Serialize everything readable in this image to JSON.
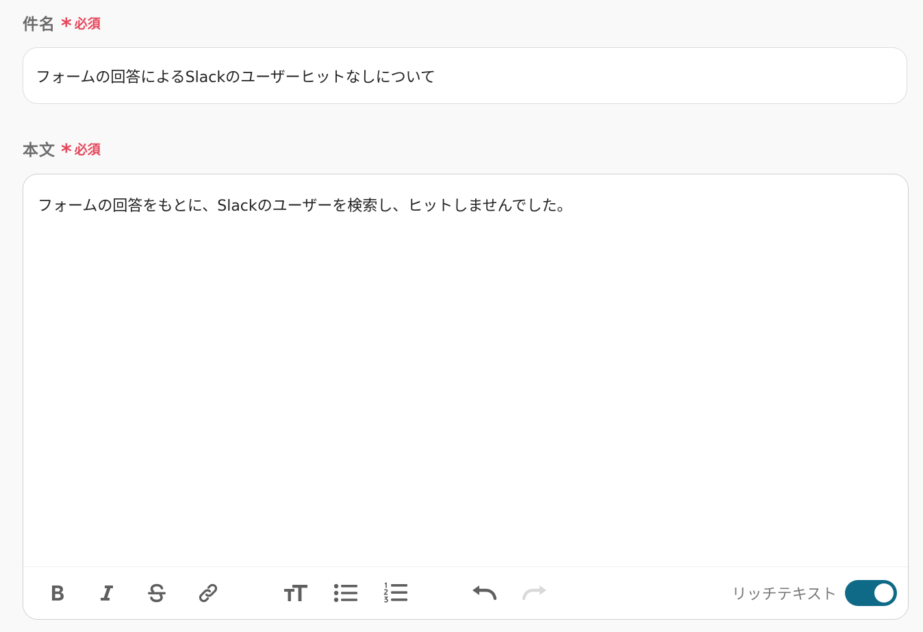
{
  "subject": {
    "label": "件名",
    "required_mark": "*",
    "required_text": "必須",
    "value": "フォームの回答によるSlackのユーザーヒットなしについて"
  },
  "body": {
    "label": "本文",
    "required_mark": "*",
    "required_text": "必須",
    "value": "フォームの回答をもとに、Slackのユーザーを検索し、ヒットしませんでした。"
  },
  "toolbar": {
    "icons": [
      "bold-icon",
      "italic-icon",
      "strikethrough-icon",
      "link-icon",
      "text-size-icon",
      "bullet-list-icon",
      "numbered-list-icon",
      "undo-icon",
      "redo-icon"
    ],
    "rich_text_label": "リッチテキスト",
    "rich_text_enabled": true
  },
  "colors": {
    "required": "#e5475b",
    "toggle_on": "#0f6a87",
    "icon": "#5f5f5f",
    "icon_disabled": "#d9d9d9"
  }
}
